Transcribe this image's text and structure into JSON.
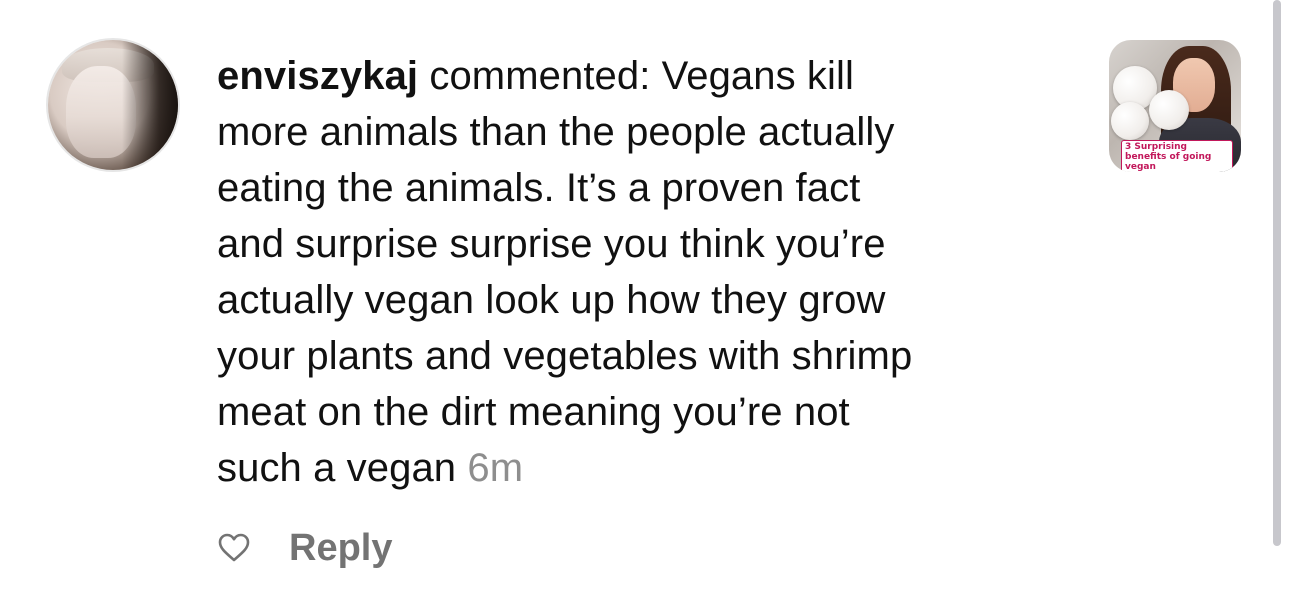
{
  "comment": {
    "username": "enviszykaj",
    "text": " commented: Vegans kill\nmore animals than the people actually\neating the animals. It’s a proven fact\nand surprise surprise you think you’re\nactually vegan look up how they grow\nyour plants and vegetables with shrimp\nmeat on the dirt meaning you’re not\nsuch a vegan ",
    "time": "6m"
  },
  "actions": {
    "like_icon": "heart-icon",
    "reply_label": "Reply"
  },
  "post_thumbnail": {
    "caption": "3 Surprising benefits of going vegan"
  },
  "colors": {
    "text": "#111111",
    "muted": "#8e8e8e",
    "reply": "#737373",
    "caption_accent": "#c2185b"
  }
}
